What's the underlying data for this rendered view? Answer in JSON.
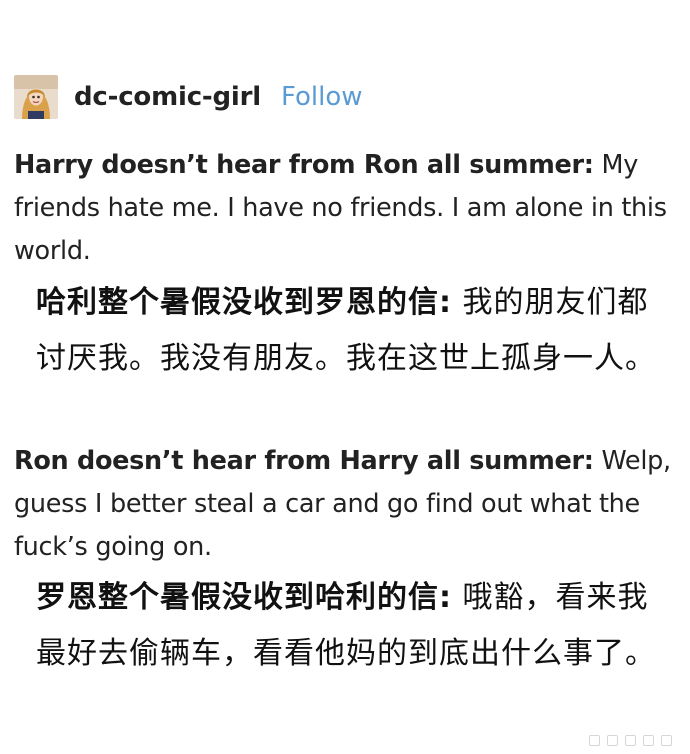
{
  "header": {
    "username": "dc-comic-girl",
    "follow_label": "Follow",
    "avatar_icon": "profile-avatar"
  },
  "post": {
    "paragraph_1": {
      "bold": "Harry doesn’t hear from Ron all summer:",
      "rest": " My friends hate me. I have no friends. I am alone in this world."
    },
    "translation_1": {
      "bold": "哈利整个暑假没收到罗恩的信:",
      "rest": " 我的朋友们都讨厌我。我没有朋友。我在这世上孤身一人。"
    },
    "paragraph_2": {
      "bold": "Ron doesn’t hear from Harry all summer:",
      "rest": " Welp, guess I better steal a car and go find out what the fuck’s going on."
    },
    "translation_2": {
      "bold": "罗恩整个暑假没收到哈利的信:",
      "rest": " 哦豁，看来我最好去偷辆车，看看他妈的到底出什么事了。"
    }
  },
  "colors": {
    "follow": "#5a9bd5",
    "text": "#222222"
  }
}
